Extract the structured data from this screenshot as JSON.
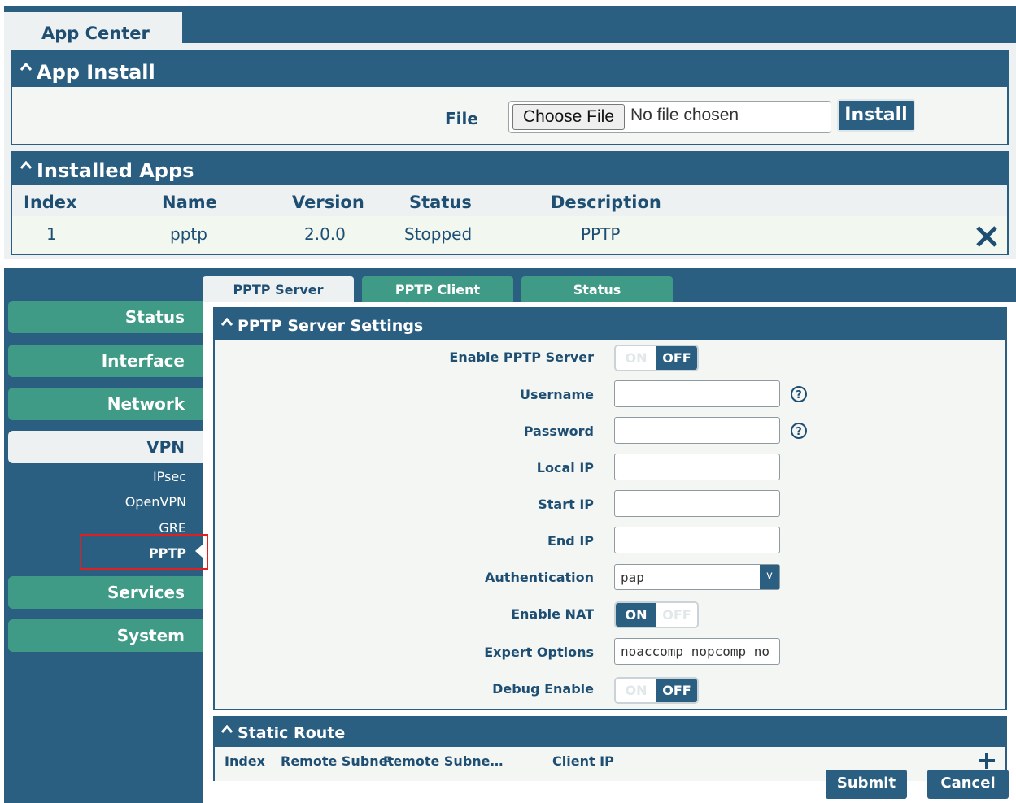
{
  "app_center": {
    "tab_label": "App Center",
    "app_install": {
      "title": "App Install",
      "file_label": "File",
      "choose_file_label": "Choose File",
      "no_file_text": "No file chosen",
      "install_label": "Install"
    },
    "installed_apps": {
      "title": "Installed Apps",
      "columns": [
        "Index",
        "Name",
        "Version",
        "Status",
        "Description"
      ],
      "rows": [
        {
          "index": "1",
          "name": "pptp",
          "version": "2.0.0",
          "status": "Stopped",
          "description": "PPTP"
        }
      ]
    }
  },
  "sidebar": {
    "items": [
      {
        "label": "Status"
      },
      {
        "label": "Interface"
      },
      {
        "label": "Network"
      },
      {
        "label": "VPN",
        "active": true
      },
      {
        "label": "Services"
      },
      {
        "label": "System"
      }
    ],
    "vpn_sub_items": [
      {
        "label": "IPsec"
      },
      {
        "label": "OpenVPN"
      },
      {
        "label": "GRE"
      },
      {
        "label": "PPTP",
        "active": true
      }
    ]
  },
  "tabs": [
    {
      "label": "PPTP Server",
      "active": true
    },
    {
      "label": "PPTP Client"
    },
    {
      "label": "Status"
    }
  ],
  "pptp_server_settings": {
    "title": "PPTP Server Settings",
    "fields": {
      "enable_pptp_server": {
        "label": "Enable PPTP Server",
        "on_label": "ON",
        "off_label": "OFF",
        "value": "OFF"
      },
      "username": {
        "label": "Username",
        "value": ""
      },
      "password": {
        "label": "Password",
        "value": ""
      },
      "local_ip": {
        "label": "Local IP",
        "value": ""
      },
      "start_ip": {
        "label": "Start IP",
        "value": ""
      },
      "end_ip": {
        "label": "End IP",
        "value": ""
      },
      "authentication": {
        "label": "Authentication",
        "value": "pap",
        "arrow": "v"
      },
      "enable_nat": {
        "label": "Enable NAT",
        "on_label": "ON",
        "off_label": "OFF",
        "value": "ON"
      },
      "expert_options": {
        "label": "Expert Options",
        "value": "noaccomp nopcomp no"
      },
      "debug_enable": {
        "label": "Debug Enable",
        "on_label": "ON",
        "off_label": "OFF",
        "value": "OFF"
      }
    }
  },
  "static_route": {
    "title": "Static Route",
    "columns": [
      "Index",
      "Remote Subnet",
      "Remote Subne…",
      "Client IP"
    ]
  },
  "actions": {
    "submit_label": "Submit",
    "cancel_label": "Cancel"
  },
  "colors": {
    "primary": "#2a5f82",
    "accent_green": "#3f9b86",
    "highlight_red": "#e02020"
  },
  "icons": {
    "section_toggle": "caret-up-icon",
    "delete": "close-icon",
    "help": "help-icon",
    "add": "plus-icon",
    "pointer": "triangle-left-icon"
  }
}
